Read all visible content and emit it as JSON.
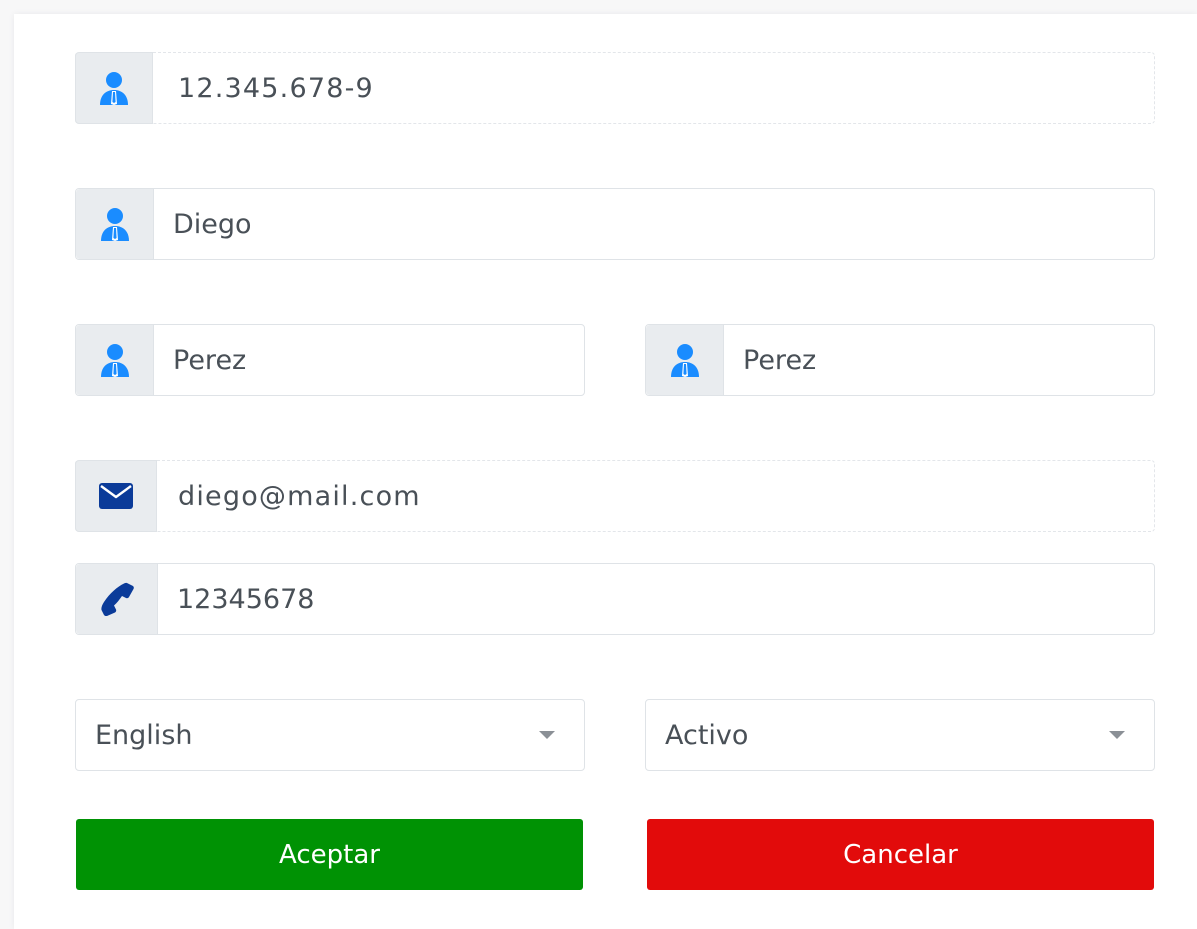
{
  "form": {
    "rut": {
      "value": "12.345.678-9",
      "icon": "user-tie-icon"
    },
    "first_name": {
      "value": "Diego",
      "icon": "user-tie-icon"
    },
    "last_name_paternal": {
      "value": "Perez",
      "icon": "user-tie-icon"
    },
    "last_name_maternal": {
      "value": "Perez",
      "icon": "user-tie-icon"
    },
    "email": {
      "value": "diego@mail.com",
      "icon": "envelope-icon"
    },
    "phone": {
      "value": "12345678",
      "icon": "phone-icon"
    },
    "language": {
      "selected": "English",
      "icon": "chevron-down-icon"
    },
    "status": {
      "selected": "Activo",
      "icon": "chevron-down-icon"
    }
  },
  "actions": {
    "accept_label": "Aceptar",
    "cancel_label": "Cancelar"
  },
  "colors": {
    "user_icon": "#1a8cff",
    "contact_icon": "#0b3b99",
    "accept": "#009204",
    "cancel": "#e20b0b",
    "addon_bg": "#e9ecef"
  }
}
